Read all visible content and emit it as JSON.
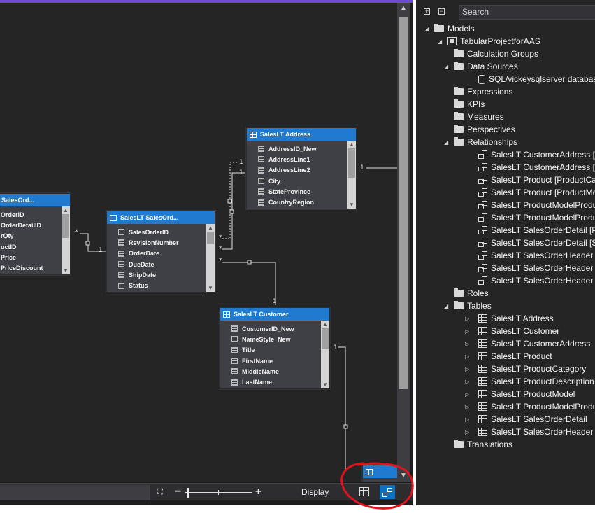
{
  "diagram": {
    "tables": {
      "sales_order_detail": {
        "title": "SalesOrd...",
        "columns": [
          "SalesOrderID",
          "SalesOrderDetailID",
          "OrderQty",
          "ProductID",
          "UnitPrice",
          "UnitPriceDiscount"
        ],
        "display_columns": [
          "OrderID",
          "OrderDetailID",
          "rQty",
          "uctID",
          "Price",
          "PriceDiscount"
        ]
      },
      "sales_order_header": {
        "title": "SalesLT SalesOrd...",
        "columns": [
          "SalesOrderID",
          "RevisionNumber",
          "OrderDate",
          "DueDate",
          "ShipDate",
          "Status"
        ]
      },
      "address": {
        "title": "SalesLT Address",
        "columns": [
          "AddressID_New",
          "AddressLine1",
          "AddressLine2",
          "City",
          "StateProvince",
          "CountryRegion"
        ]
      },
      "customer": {
        "title": "SalesLT Customer",
        "columns": [
          "CustomerID_New",
          "NameStyle_New",
          "Title",
          "FirstName",
          "MiddleName",
          "LastName"
        ]
      }
    },
    "cardinality": {
      "many": "*",
      "one": "1"
    },
    "toolbar": {
      "minus": "−",
      "plus": "+",
      "display_label": "Display"
    }
  },
  "explorer": {
    "search_placeholder": "Search",
    "tree": {
      "models": "Models",
      "project": "TabularProjectforAAS",
      "calculation_groups": "Calculation Groups",
      "data_sources": "Data Sources",
      "data_source_item": "SQL/vickeysqlserver databas",
      "expressions": "Expressions",
      "kpis": "KPIs",
      "measures": "Measures",
      "perspectives": "Perspectives",
      "relationships": "Relationships",
      "relationship_items": [
        "SalesLT CustomerAddress [A",
        "SalesLT CustomerAddress [C",
        "SalesLT Product [ProductCat",
        "SalesLT Product [ProductMo",
        "SalesLT ProductModelProdu",
        "SalesLT ProductModelProdu",
        "SalesLT SalesOrderDetail [Pro",
        "SalesLT SalesOrderDetail [Sal",
        "SalesLT SalesOrderHeader [B",
        "SalesLT SalesOrderHeader [C",
        "SalesLT SalesOrderHeader [S"
      ],
      "roles": "Roles",
      "tables": "Tables",
      "table_items": [
        "SalesLT Address",
        "SalesLT Customer",
        "SalesLT CustomerAddress",
        "SalesLT Product",
        "SalesLT ProductCategory",
        "SalesLT ProductDescription",
        "SalesLT ProductModel",
        "SalesLT ProductModelProdu",
        "SalesLT SalesOrderDetail",
        "SalesLT SalesOrderHeader"
      ],
      "translations": "Translations"
    }
  },
  "colors": {
    "table_header": "#1f7ad0",
    "canvas": "#252526",
    "selected_button": "#0e70c0",
    "annotation": "#e0141e"
  }
}
